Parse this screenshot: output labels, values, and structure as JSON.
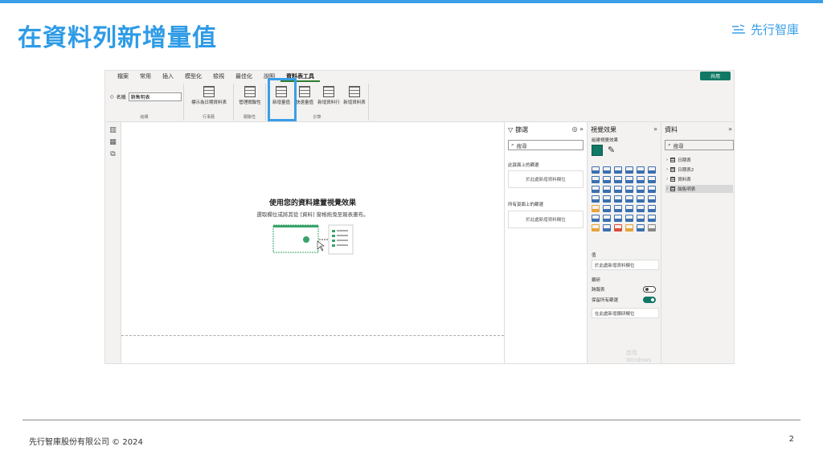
{
  "slide": {
    "title": "在資料列新增量值",
    "brand": "先行智庫",
    "footer": "先行智庫股份有限公司 © 2024",
    "page": "2",
    "accent": "#2e9be6"
  },
  "ribbon": {
    "tabs": [
      "檔案",
      "常用",
      "插入",
      "模型化",
      "檢視",
      "最佳化",
      "說明",
      "資料表工具"
    ],
    "active_tab": "資料表工具",
    "share": "共用",
    "name_label": "名稱",
    "name_value": "銷售明表",
    "buttons": {
      "mark_date": "標示為日期資料表",
      "manage_rel": "管理關聯性",
      "new_measure": "新增量值",
      "quick_measure": "快速量值",
      "new_column": "新增資料行",
      "new_table": "新增資料表"
    },
    "groups": {
      "structure": "結構",
      "calendar": "行事曆",
      "relationships": "關聯性",
      "calculations": "計算"
    }
  },
  "canvas": {
    "title": "使用您的資料建置視覺效果",
    "subtitle": "選取欄位或將其從 [資料] 窗格拖曳至報表畫布。"
  },
  "filters": {
    "title": "篩選",
    "search_placeholder": "搜尋",
    "page_section": "此頁面上的篩選",
    "all_section": "所有頁面上的篩選",
    "drop_text": "於此處新增資料欄位"
  },
  "visualizations": {
    "title": "視覺效果",
    "build_label": "組建視覺效果",
    "values_label": "值",
    "drillthrough_label": "鑽研",
    "cross_report": "跨報表",
    "keep_filters": "保留所有篩選",
    "drop_values": "於此處新增資料欄位",
    "drop_drill": "在此處新增鑽研欄位",
    "cross_report_on": false,
    "keep_filters_on": true,
    "watermark": "啟用 Windows",
    "icon_colors": [
      "#3a6fb0",
      "#3a6fb0",
      "#3a6fb0",
      "#3a6fb0",
      "#3a6fb0",
      "#3a6fb0",
      "#3a6fb0",
      "#3a6fb0",
      "#3a6fb0",
      "#3a6fb0",
      "#3a6fb0",
      "#3a6fb0",
      "#3a6fb0",
      "#3a6fb0",
      "#3a6fb0",
      "#3a6fb0",
      "#3a6fb0",
      "#3a6fb0",
      "#3a6fb0",
      "#3a6fb0",
      "#3a6fb0",
      "#3a6fb0",
      "#3a6fb0",
      "#3a6fb0",
      "#e8a33a",
      "#3a6fb0",
      "#3a6fb0",
      "#3a6fb0",
      "#3a6fb0",
      "#3a6fb0",
      "#3a6fb0",
      "#3a6fb0",
      "#3a6fb0",
      "#3a6fb0",
      "#3a6fb0",
      "#3a6fb0",
      "#e8a33a",
      "#3a6fb0",
      "#d84e3a",
      "#e8a33a",
      "#3a6fb0",
      "#888888"
    ]
  },
  "data_pane": {
    "title": "資料",
    "search_placeholder": "搜尋",
    "tables": [
      "日期表",
      "日期表2",
      "資料表",
      "銷售明表"
    ],
    "selected": "銷售明表"
  }
}
